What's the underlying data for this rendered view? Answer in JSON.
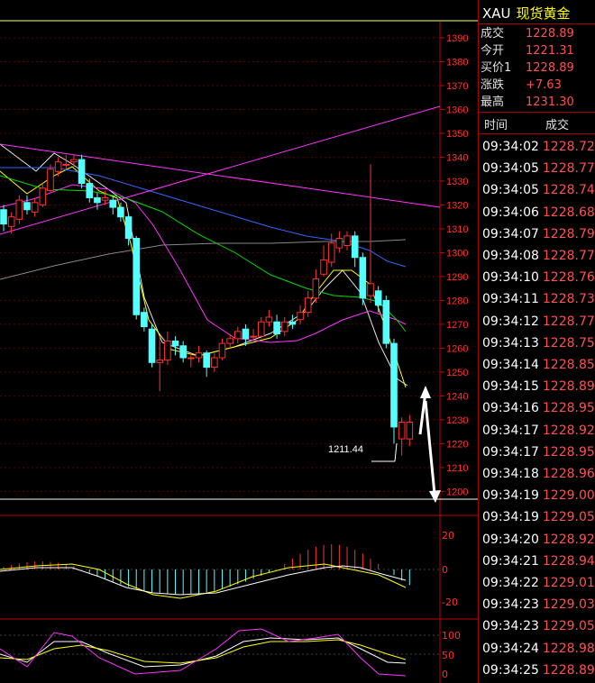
{
  "quote": {
    "symbol": "XAU",
    "name": "现货黄金",
    "rows": [
      {
        "label": "成交",
        "value": "1228.89"
      },
      {
        "label": "今开",
        "value": "1221.31"
      },
      {
        "label": "买价1",
        "value": "1228.89"
      },
      {
        "label": "涨跌",
        "value": "+7.63"
      },
      {
        "label": "最高",
        "value": "1231.30"
      }
    ]
  },
  "ticks_header": {
    "time": "时间",
    "price": "成交"
  },
  "ticks": [
    {
      "time": "09:34:02",
      "price": "1228.72"
    },
    {
      "time": "09:34:05",
      "price": "1228.77"
    },
    {
      "time": "09:34:05",
      "price": "1228.74"
    },
    {
      "time": "09:34:06",
      "price": "1228.68"
    },
    {
      "time": "09:34:07",
      "price": "1228.79"
    },
    {
      "time": "09:34:08",
      "price": "1228.77"
    },
    {
      "time": "09:34:10",
      "price": "1228.76"
    },
    {
      "time": "09:34:11",
      "price": "1228.73"
    },
    {
      "time": "09:34:12",
      "price": "1228.77"
    },
    {
      "time": "09:34:13",
      "price": "1228.75"
    },
    {
      "time": "09:34:14",
      "price": "1228.85"
    },
    {
      "time": "09:34:15",
      "price": "1228.89"
    },
    {
      "time": "09:34:16",
      "price": "1228.95"
    },
    {
      "time": "09:34:17",
      "price": "1228.92"
    },
    {
      "time": "09:34:17",
      "price": "1228.95"
    },
    {
      "time": "09:34:18",
      "price": "1228.96"
    },
    {
      "time": "09:34:19",
      "price": "1229.00"
    },
    {
      "time": "09:34:19",
      "price": "1229.05"
    },
    {
      "time": "09:34:20",
      "price": "1228.92"
    },
    {
      "time": "09:34:21",
      "price": "1228.94"
    },
    {
      "time": "09:34:22",
      "price": "1229.01"
    },
    {
      "time": "09:34:23",
      "price": "1229.03"
    },
    {
      "time": "09:34:23",
      "price": "1229.05"
    },
    {
      "time": "09:34:24",
      "price": "1228.98"
    },
    {
      "time": "09:34:25",
      "price": "1228.89"
    }
  ],
  "chart_data": {
    "type": "candlestick",
    "ylim": [
      1196,
      1393
    ],
    "yticks": [
      1200,
      1210,
      1220,
      1230,
      1240,
      1250,
      1260,
      1270,
      1280,
      1290,
      1300,
      1310,
      1320,
      1330,
      1340,
      1350,
      1360,
      1370,
      1380,
      1390
    ],
    "low_annotation": "1211.44",
    "candles": [
      [
        1318,
        1312,
        1320,
        1309
      ],
      [
        1311,
        1315,
        1317,
        1308
      ],
      [
        1314,
        1322,
        1324,
        1312
      ],
      [
        1321,
        1318,
        1324,
        1316
      ],
      [
        1317,
        1321,
        1323,
        1315
      ],
      [
        1320,
        1327,
        1329,
        1319
      ],
      [
        1326,
        1335,
        1337,
        1325
      ],
      [
        1334,
        1338,
        1340,
        1332
      ],
      [
        1337,
        1337,
        1341,
        1335
      ],
      [
        1338,
        1339,
        1341,
        1336
      ],
      [
        1339,
        1329,
        1341,
        1327
      ],
      [
        1329,
        1323,
        1331,
        1321
      ],
      [
        1323,
        1321,
        1325,
        1318
      ],
      [
        1322,
        1323,
        1326,
        1320
      ],
      [
        1322,
        1319,
        1324,
        1316
      ],
      [
        1319,
        1315,
        1321,
        1313
      ],
      [
        1315,
        1306,
        1316,
        1303
      ],
      [
        1306,
        1274,
        1307,
        1272
      ],
      [
        1275,
        1269,
        1277,
        1267
      ],
      [
        1268,
        1254,
        1270,
        1252
      ],
      [
        1254,
        1255,
        1265,
        1242
      ],
      [
        1255,
        1263,
        1267,
        1253
      ],
      [
        1263,
        1261,
        1265,
        1257
      ],
      [
        1261,
        1256,
        1263,
        1254
      ],
      [
        1256,
        1256,
        1258,
        1252
      ],
      [
        1256,
        1258,
        1261,
        1254
      ],
      [
        1258,
        1252,
        1259,
        1248
      ],
      [
        1252,
        1256,
        1258,
        1250
      ],
      [
        1256,
        1262,
        1264,
        1255
      ],
      [
        1262,
        1264,
        1266,
        1260
      ],
      [
        1264,
        1267,
        1269,
        1262
      ],
      [
        1268,
        1264,
        1270,
        1261
      ],
      [
        1265,
        1265,
        1268,
        1263
      ],
      [
        1265,
        1271,
        1273,
        1264
      ],
      [
        1271,
        1273,
        1276,
        1269
      ],
      [
        1271,
        1266,
        1274,
        1264
      ],
      [
        1267,
        1271,
        1273,
        1265
      ],
      [
        1271,
        1270,
        1274,
        1268
      ],
      [
        1272,
        1275,
        1278,
        1270
      ],
      [
        1275,
        1281,
        1284,
        1273
      ],
      [
        1281,
        1289,
        1293,
        1279
      ],
      [
        1291,
        1297,
        1303,
        1290
      ],
      [
        1296,
        1304,
        1308,
        1294
      ],
      [
        1302,
        1306,
        1309,
        1300
      ],
      [
        1303,
        1307,
        1309,
        1301
      ],
      [
        1307,
        1298,
        1309,
        1294
      ],
      [
        1298,
        1281,
        1300,
        1278
      ],
      [
        1282,
        1287,
        1337,
        1279
      ],
      [
        1284,
        1278,
        1286,
        1275
      ],
      [
        1280,
        1262,
        1282,
        1260
      ],
      [
        1262,
        1227,
        1264,
        1220
      ],
      [
        1222,
        1229,
        1231,
        1215
      ],
      [
        1222,
        1229,
        1232,
        1219
      ]
    ],
    "macd_axis": [
      "20",
      "0",
      "-20"
    ],
    "kdj_axis": [
      "100",
      "50",
      "0"
    ]
  }
}
